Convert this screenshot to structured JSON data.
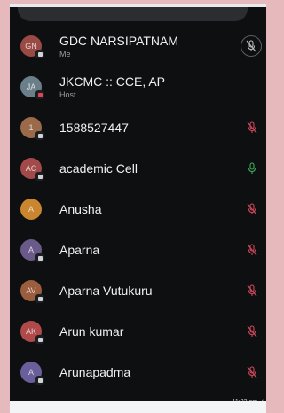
{
  "participants": [
    {
      "initials": "GN",
      "name": "GDC NARSIPATNAM",
      "sub": "Me",
      "avatar_color": "#9a4a44",
      "badge": "device",
      "mic": "muted-circled"
    },
    {
      "initials": "JA",
      "name": "JKCMC :: CCE, AP",
      "sub": "Host",
      "avatar_color": "#6b7f8a",
      "badge": "host",
      "mic": "none"
    },
    {
      "initials": "1",
      "name": "1588527447",
      "sub": "",
      "avatar_color": "#9a6a4a",
      "badge": "device",
      "mic": "muted"
    },
    {
      "initials": "AC",
      "name": "academic Cell",
      "sub": "",
      "avatar_color": "#a24a4a",
      "badge": "device",
      "mic": "unmuted"
    },
    {
      "initials": "A",
      "name": "Anusha",
      "sub": "",
      "avatar_color": "#c9862e",
      "badge": "none",
      "mic": "muted"
    },
    {
      "initials": "A",
      "name": "Aparna",
      "sub": "",
      "avatar_color": "#6a5a8a",
      "badge": "device",
      "mic": "muted"
    },
    {
      "initials": "AV",
      "name": "Aparna Vutukuru",
      "sub": "",
      "avatar_color": "#9a5e3e",
      "badge": "device",
      "mic": "muted"
    },
    {
      "initials": "AK",
      "name": "Arun kumar",
      "sub": "",
      "avatar_color": "#b04a4a",
      "badge": "device",
      "mic": "muted"
    },
    {
      "initials": "A",
      "name": "Arunapadma",
      "sub": "",
      "avatar_color": "#6a5f9a",
      "badge": "device",
      "mic": "muted"
    }
  ],
  "timestamp": "11:22 am ✓",
  "colors": {
    "muted": "#d0485c",
    "unmuted": "#3fae5a",
    "muted_circled": "#b7bcc2"
  }
}
